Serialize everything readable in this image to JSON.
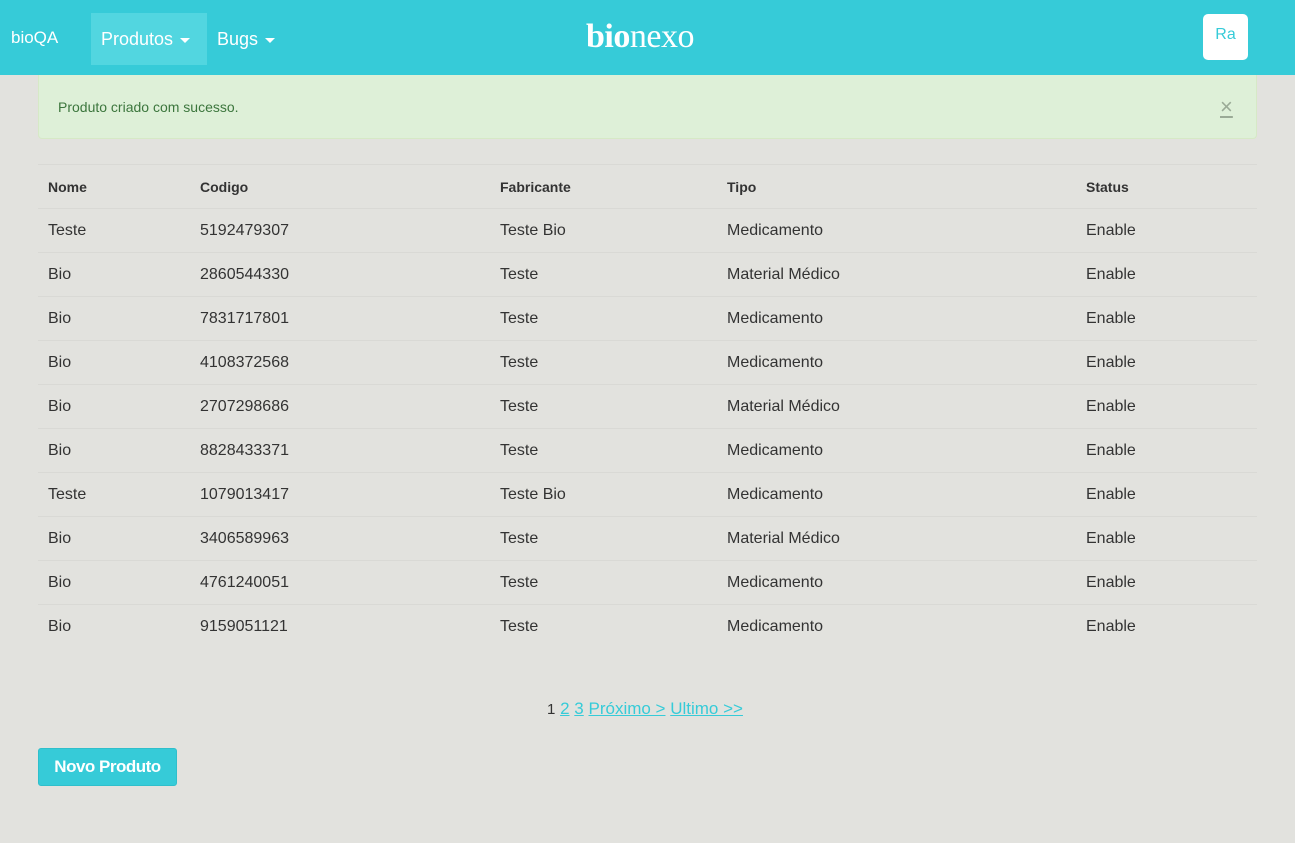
{
  "navbar": {
    "brand": "bioQA",
    "menus": [
      {
        "label": "Produtos",
        "active": true
      },
      {
        "label": "Bugs",
        "active": false
      }
    ],
    "logo_part1": "bio",
    "logo_part2": "nexo",
    "user_label": "Ra",
    "color": "#36cbd8"
  },
  "alert": {
    "message": "Produto criado com sucesso.",
    "close_glyph": "×"
  },
  "table": {
    "headers": [
      "Nome",
      "Codigo",
      "Fabricante",
      "Tipo",
      "Status"
    ],
    "rows": [
      [
        "Teste",
        "5192479307",
        "Teste Bio",
        "Medicamento",
        "Enable"
      ],
      [
        "Bio",
        "2860544330",
        "Teste",
        "Material Médico",
        "Enable"
      ],
      [
        "Bio",
        "7831717801",
        "Teste",
        "Medicamento",
        "Enable"
      ],
      [
        "Bio",
        "4108372568",
        "Teste",
        "Medicamento",
        "Enable"
      ],
      [
        "Bio",
        "2707298686",
        "Teste",
        "Material Médico",
        "Enable"
      ],
      [
        "Bio",
        "8828433371",
        "Teste",
        "Medicamento",
        "Enable"
      ],
      [
        "Teste",
        "1079013417",
        "Teste Bio",
        "Medicamento",
        "Enable"
      ],
      [
        "Bio",
        "3406589963",
        "Teste",
        "Material Médico",
        "Enable"
      ],
      [
        "Bio",
        "4761240051",
        "Teste",
        "Medicamento",
        "Enable"
      ],
      [
        "Bio",
        "9159051121",
        "Teste",
        "Medicamento",
        "Enable"
      ]
    ]
  },
  "pagination": {
    "current": "1",
    "pages": [
      "2",
      "3"
    ],
    "next_label": "Próximo >",
    "last_label": "Ultimo >>"
  },
  "actions": {
    "new_product_label": "Novo Produto"
  }
}
